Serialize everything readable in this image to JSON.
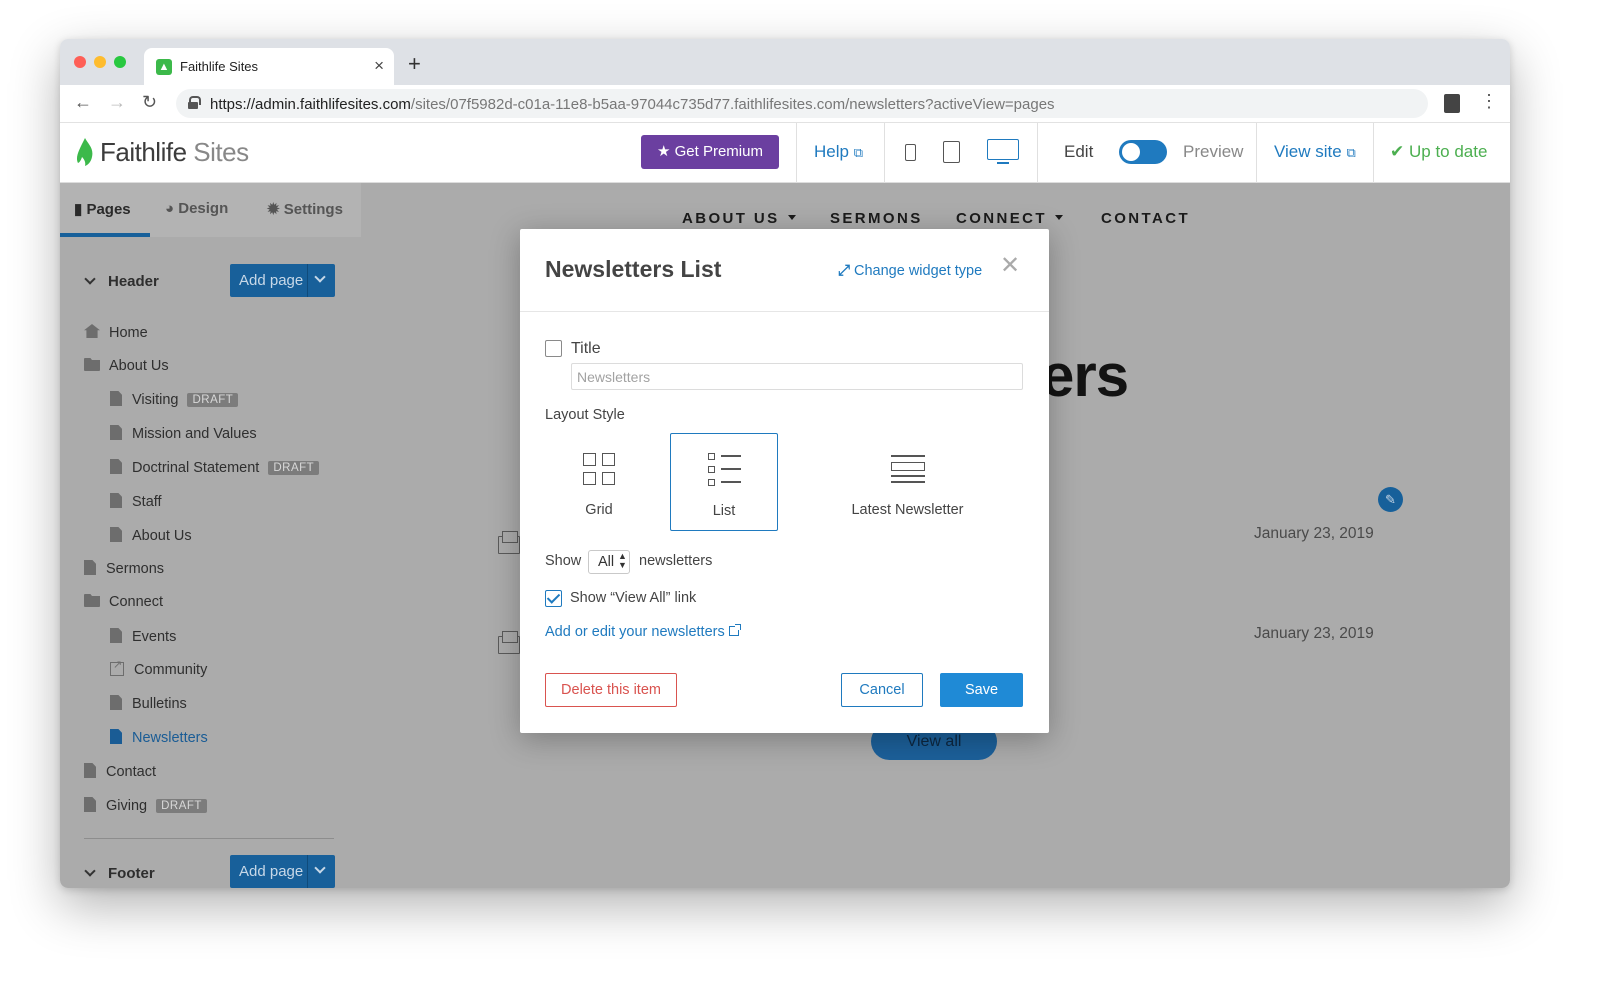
{
  "browser": {
    "tab_title": "Faithlife Sites",
    "url_host": "https://admin.faithlifesites.com",
    "url_path": "/sites/07f5982d-c01a-11e8-b5aa-97044c735d77.faithlifesites.com/newsletters?activeView=pages"
  },
  "header": {
    "logo_main": "Faithlife",
    "logo_sub": "Sites",
    "premium_label": "Get Premium",
    "help_label": "Help",
    "edit_label": "Edit",
    "preview_label": "Preview",
    "view_site_label": "View site",
    "status_label": "Up to date"
  },
  "sidebar": {
    "tabs": [
      "Pages",
      "Design",
      "Settings"
    ],
    "header_section": "Header",
    "footer_section": "Footer",
    "add_page_label": "Add page",
    "draft_badge": "DRAFT",
    "pages": [
      {
        "label": "Home"
      },
      {
        "label": "About Us"
      },
      {
        "label": "Visiting"
      },
      {
        "label": "Mission and Values"
      },
      {
        "label": "Doctrinal Statement"
      },
      {
        "label": "Staff"
      },
      {
        "label": "About Us"
      },
      {
        "label": "Sermons"
      },
      {
        "label": "Connect"
      },
      {
        "label": "Events"
      },
      {
        "label": "Community"
      },
      {
        "label": "Bulletins"
      },
      {
        "label": "Newsletters"
      },
      {
        "label": "Contact"
      },
      {
        "label": "Giving"
      }
    ]
  },
  "site": {
    "nav": [
      "ABOUT US",
      "SERMONS",
      "CONNECT",
      "CONTACT"
    ],
    "heading_visible": "ers",
    "dates": [
      "January 23, 2019",
      "January 23, 2019"
    ],
    "view_all_label": "View all"
  },
  "modal": {
    "title": "Newsletters List",
    "change_widget_label": "Change widget type",
    "title_checkbox_label": "Title",
    "title_placeholder": "Newsletters",
    "layout_style_label": "Layout Style",
    "layouts": [
      "Grid",
      "List",
      "Latest Newsletter"
    ],
    "selected_layout": "List",
    "show_label": "Show",
    "show_value": "All",
    "newsletters_label": "newsletters",
    "show_view_all_label": "Show “View All” link",
    "edit_link_label": "Add or edit your newsletters",
    "delete_label": "Delete this item",
    "cancel_label": "Cancel",
    "save_label": "Save"
  },
  "colors": {
    "accent": "#1f7abf",
    "premium": "#6b3fa0",
    "danger": "#d9534f",
    "success": "#4caf50"
  }
}
